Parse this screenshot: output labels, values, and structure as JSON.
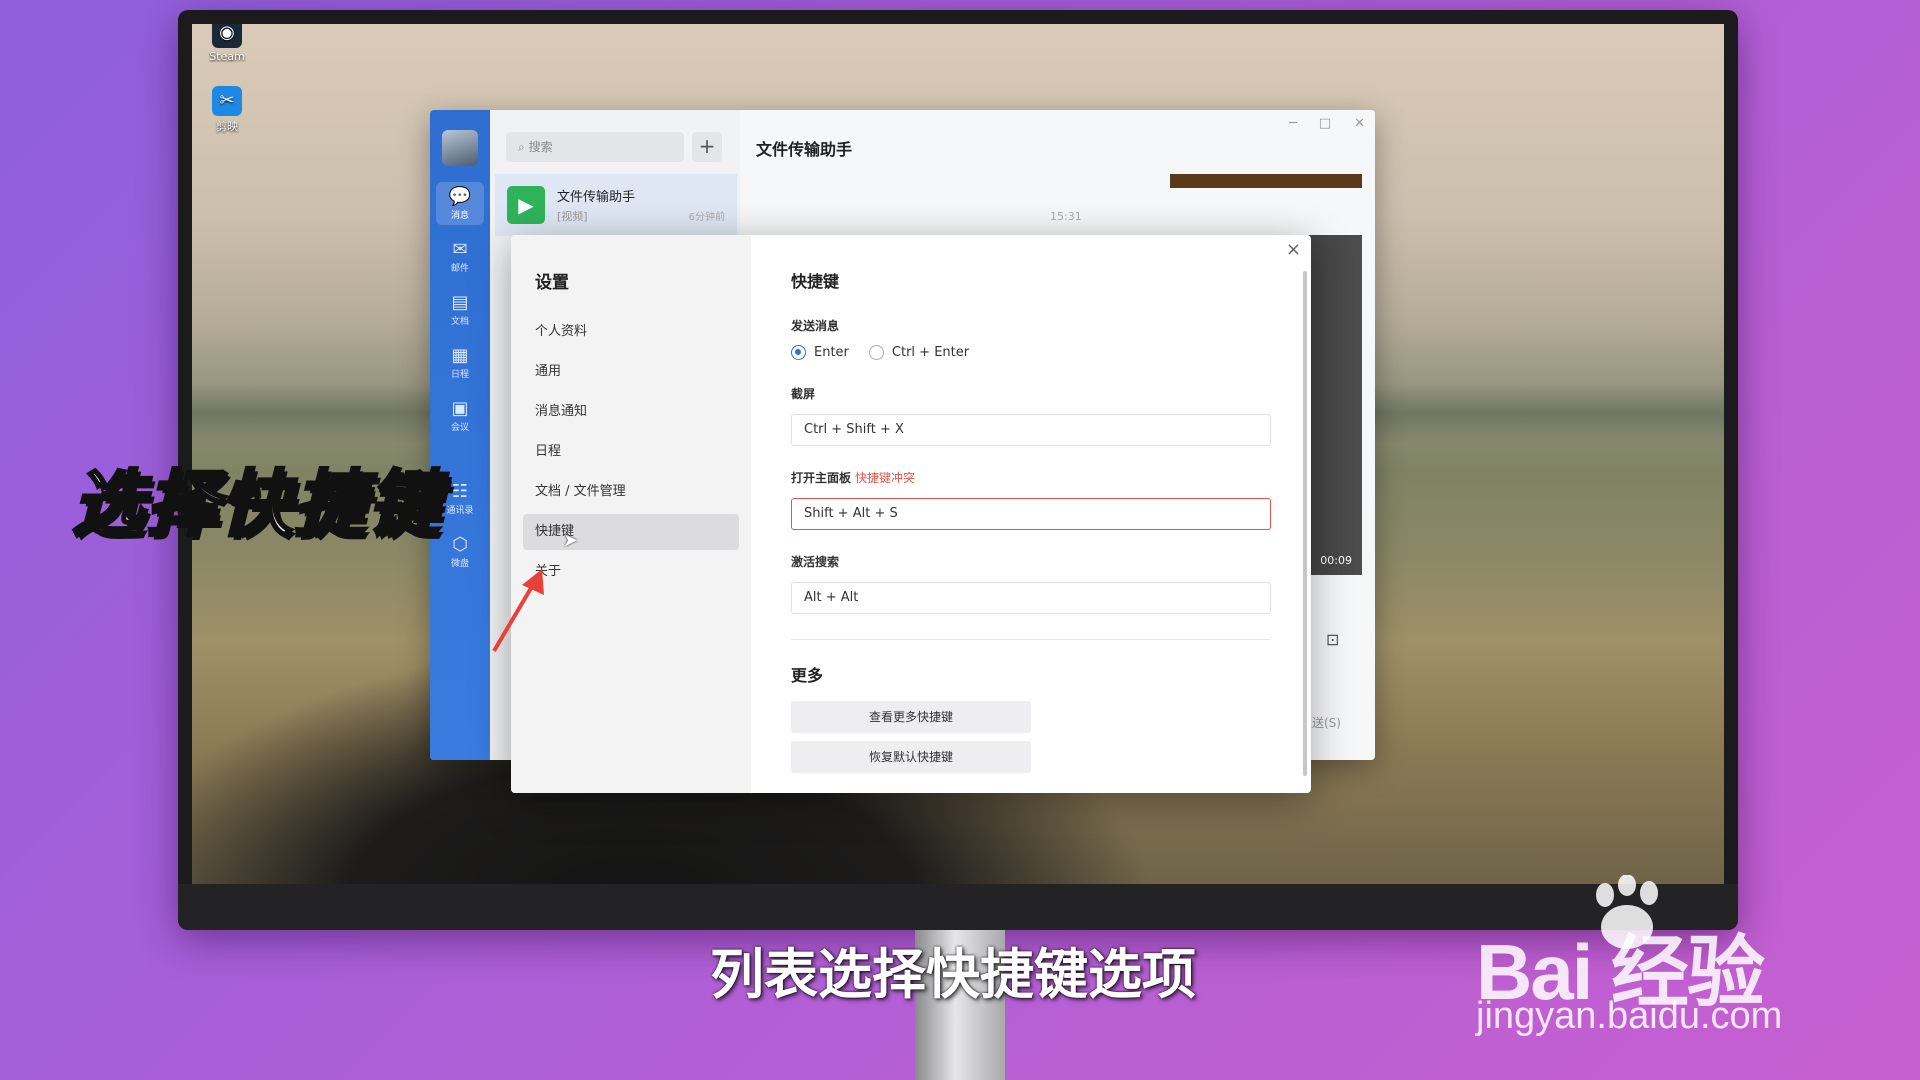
{
  "desktop": {
    "icons": [
      {
        "label": "Steam"
      },
      {
        "label": "剪映"
      }
    ]
  },
  "app": {
    "rail": [
      {
        "label": "消息",
        "icon": "chat-icon"
      },
      {
        "label": "邮件",
        "icon": "mail-icon"
      },
      {
        "label": "文档",
        "icon": "doc-icon"
      },
      {
        "label": "日程",
        "icon": "calendar-icon"
      },
      {
        "label": "会议",
        "icon": "meeting-icon"
      },
      {
        "label": "通讯录",
        "icon": "contacts-icon"
      },
      {
        "label": "微盘",
        "icon": "drive-icon"
      }
    ],
    "search_placeholder": "搜索",
    "plus": "+",
    "chat_item": {
      "name": "文件传输助手",
      "sub": "[视频]",
      "time": "6分钟前"
    },
    "chat_title": "文件传输助手",
    "chat_time": "15:31",
    "video_duration": "00:09",
    "send_hint": "发送(S)"
  },
  "settings": {
    "title": "设置",
    "nav": [
      "个人资料",
      "通用",
      "消息通知",
      "日程",
      "文档 / 文件管理",
      "快捷键",
      "关于"
    ],
    "active_index": 5,
    "heading": "快捷键",
    "send_label": "发送消息",
    "send_options": [
      "Enter",
      "Ctrl + Enter"
    ],
    "screenshot_label": "截屏",
    "screenshot_value": "Ctrl + Shift + X",
    "open_panel_label": "打开主面板",
    "conflict_text": "快捷键冲突",
    "open_panel_value": "Shift + Alt + S",
    "search_label": "激活搜索",
    "search_value": "Alt + Alt",
    "more_heading": "更多",
    "more_btn": "查看更多快捷键",
    "reset_btn": "恢复默认快捷键",
    "close": "×"
  },
  "overlay": {
    "big_caption": "选择快捷键",
    "sub_caption": "列表选择快捷键选项",
    "watermark_brand": "Bai  经验",
    "watermark_url": "jingyan.baidu.com"
  },
  "colors": {
    "accent": "#2f6ed0",
    "warn": "#e0564a",
    "rail": "#3a7be0"
  }
}
